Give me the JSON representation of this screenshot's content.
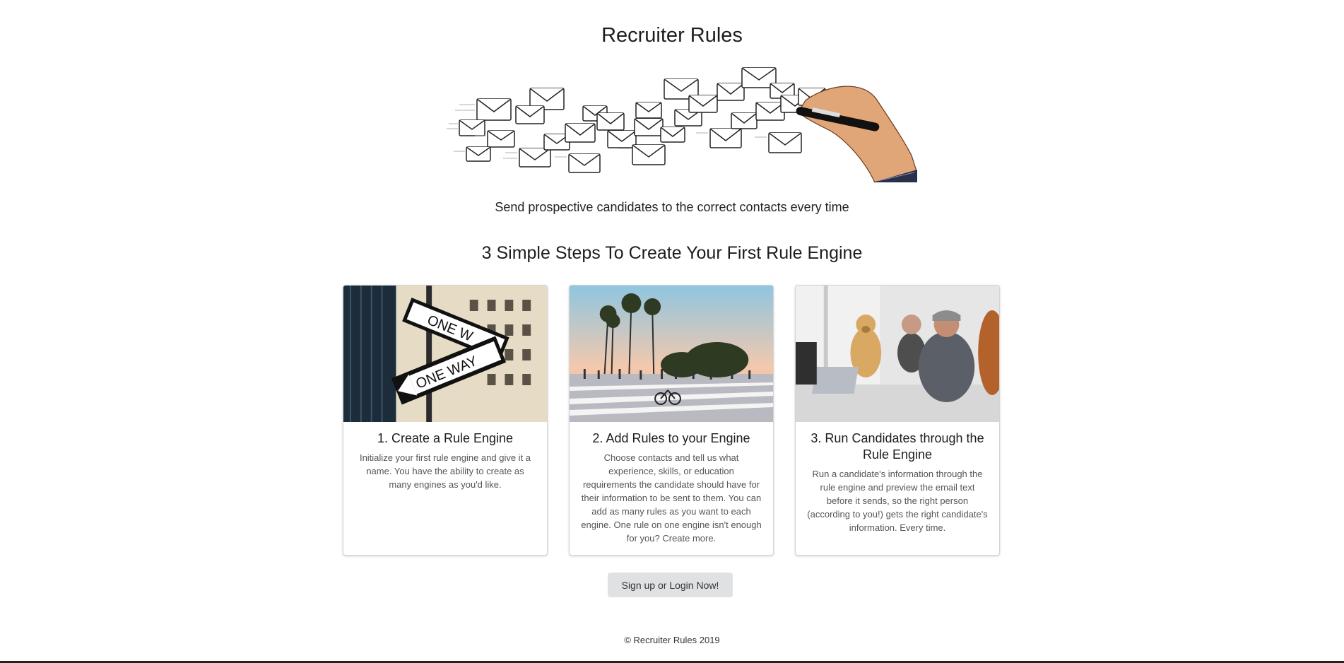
{
  "title": "Recruiter Rules",
  "hero_image": "envelopes-and-hand-illustration",
  "tagline": "Send prospective candidates to the correct contacts every time",
  "steps_heading": "3 Simple Steps To Create Your First Rule Engine",
  "cards": [
    {
      "image": "one-way-street-signs-photo",
      "title": "1. Create a Rule Engine",
      "text": "Initialize your first rule engine and give it a name. You have the ability to create as many engines as you'd like."
    },
    {
      "image": "crowded-crosswalk-palm-trees-photo",
      "title": "2. Add Rules to your Engine",
      "text": "Choose contacts and tell us what experience, skills, or education requirements the candidate should have for their information to be sent to them. You can add as many rules as you want to each engine. One rule on one engine isn't enough for you? Create more."
    },
    {
      "image": "office-meeting-with-dog-photo",
      "title": "3. Run Candidates through the Rule Engine",
      "text": "Run a candidate's information through the rule engine and preview the email text before it sends, so the right person (according to you!) gets the right candidate's information. Every time."
    }
  ],
  "cta_label": "Sign up or Login Now!",
  "footer": "© Recruiter Rules 2019",
  "colors": {
    "button_bg": "#e0e1e2",
    "card_border": "#d4d4d5"
  }
}
